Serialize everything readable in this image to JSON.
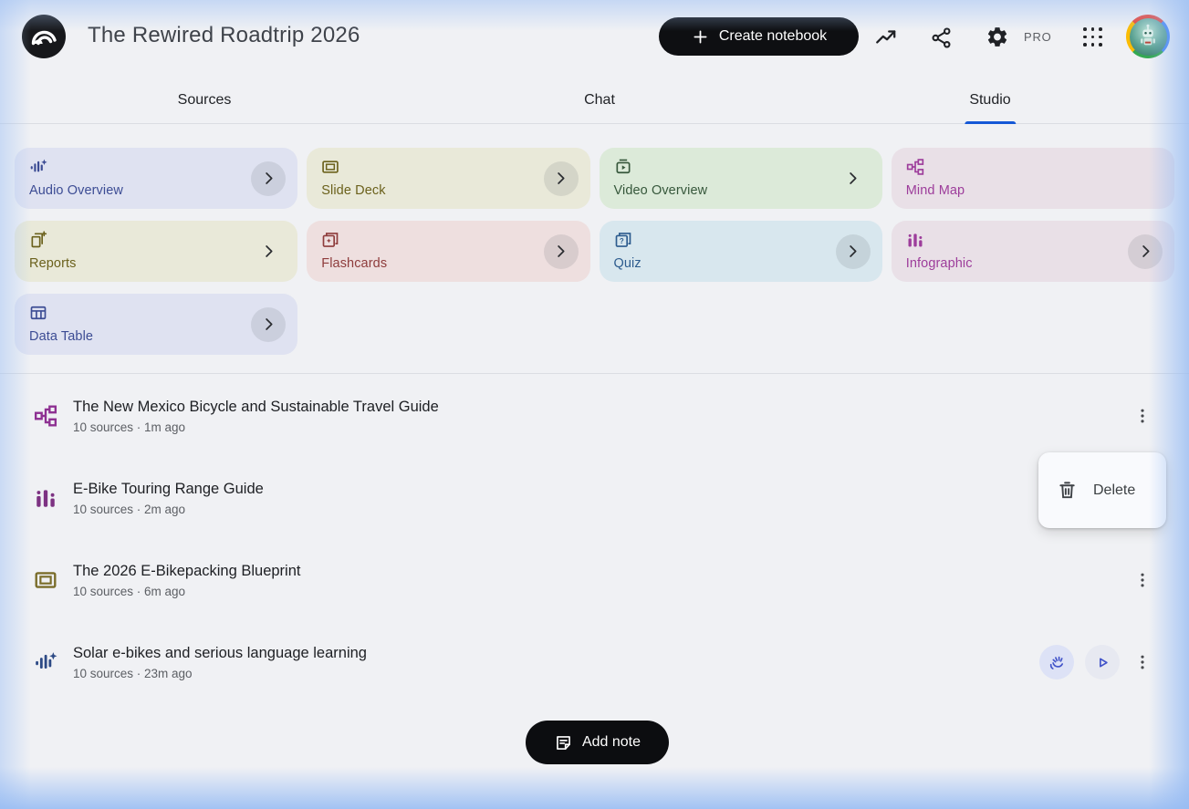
{
  "header": {
    "title": "The Rewired Roadtrip 2026",
    "create_button_label": "Create notebook",
    "pro_badge": "PRO"
  },
  "tabs": [
    {
      "label": "Sources",
      "active": false
    },
    {
      "label": "Chat",
      "active": false
    },
    {
      "label": "Studio",
      "active": true
    }
  ],
  "studio": {
    "cards": [
      {
        "label": "Audio Overview",
        "icon": "audio-waveform-sparkle-icon",
        "bg": "#dfe2f1",
        "fg": "#3c4c94",
        "chevron": true,
        "chevron_circle": true
      },
      {
        "label": "Slide Deck",
        "icon": "slide-deck-icon",
        "bg": "#e9e9d9",
        "fg": "#6b611c",
        "chevron": true,
        "chevron_circle": true
      },
      {
        "label": "Video Overview",
        "icon": "video-overview-icon",
        "bg": "#dcead9",
        "fg": "#36573b",
        "chevron": true,
        "chevron_circle": false
      },
      {
        "label": "Mind Map",
        "icon": "mind-map-icon",
        "bg": "#e9e0e7",
        "fg": "#9d3d9b",
        "chevron": false,
        "chevron_circle": false
      },
      {
        "label": "Reports",
        "icon": "reports-icon",
        "bg": "#e9e9d9",
        "fg": "#6b611c",
        "chevron": true,
        "chevron_circle": false
      },
      {
        "label": "Flashcards",
        "icon": "flashcards-icon",
        "bg": "#eedfdf",
        "fg": "#8e3c3c",
        "chevron": true,
        "chevron_circle": true
      },
      {
        "label": "Quiz",
        "icon": "quiz-icon",
        "bg": "#d8e7ee",
        "fg": "#2d5c8e",
        "chevron": true,
        "chevron_circle": true
      },
      {
        "label": "Infographic",
        "icon": "infographic-icon",
        "bg": "#e9e0e7",
        "fg": "#9d3d9b",
        "chevron": true,
        "chevron_circle": true
      },
      {
        "label": "Data Table",
        "icon": "data-table-icon",
        "bg": "#dfe2f1",
        "fg": "#3c4c94",
        "chevron": true,
        "chevron_circle": true
      }
    ]
  },
  "artifacts": [
    {
      "title": "The New Mexico Bicycle and Sustainable Travel Guide",
      "meta": "10 sources · 1m ago",
      "icon": "mind-map-icon",
      "icon_color": "#8e3192"
    },
    {
      "title": "E-Bike Touring Range Guide",
      "meta": "10 sources · 2m ago",
      "icon": "infographic-icon",
      "icon_color": "#7d3282"
    },
    {
      "title": "The 2026 E-Bikepacking Blueprint",
      "meta": "10 sources · 6m ago",
      "icon": "slide-deck-icon",
      "icon_color": "#7a6d2a"
    },
    {
      "title": "Solar e-bikes and serious language learning",
      "meta": "10 sources · 23m ago",
      "icon": "audio-waveform-sparkle-icon",
      "icon_color": "#2d4a85"
    }
  ],
  "context_menu": {
    "items": [
      {
        "label": "Delete",
        "icon": "trash-icon"
      }
    ]
  },
  "footer": {
    "add_note_label": "Add note"
  },
  "colors": {
    "accent_blue": "#1558d6",
    "pill_black": "#0e0f12",
    "page_bg": "#f0f1f4",
    "edge_glow": "#9ec0f0"
  }
}
